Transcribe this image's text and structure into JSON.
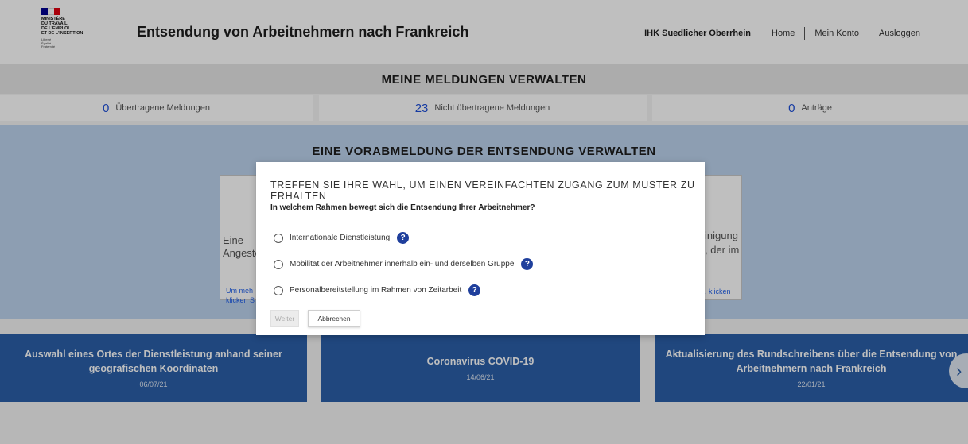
{
  "header": {
    "logo_lines": "Ministère\ndu Travail,\nde l'Emploi\net de l'Insertion",
    "logo_motto": "Liberté\nÉgalité\nFraternité",
    "site_title": "Entsendung von Arbeitnehmern nach Frankreich",
    "organization": "IHK Suedlicher Oberrhein",
    "nav": {
      "home": "Home",
      "account": "Mein Konto",
      "logout": "Ausloggen"
    }
  },
  "manage": {
    "title": "MEINE MELDUNGEN VERWALTEN",
    "counters": [
      {
        "count": "0",
        "label": "Übertragene Meldungen"
      },
      {
        "count": "23",
        "label": "Nicht übertragene Meldungen"
      },
      {
        "count": "0",
        "label": "Anträge"
      }
    ]
  },
  "preregistration": {
    "title": "EINE VORABMELDUNG DER ENTSENDUNG VERWALTEN",
    "left_card_text_1": "Eine",
    "left_card_text_2": "Angeste",
    "left_link_1": "Um meh",
    "left_link_2": "klicken S",
    "right_card_text_1": "inigung",
    "right_card_text_2": ", der im",
    "right_link": ", klicken"
  },
  "news": [
    {
      "title": "Auswahl eines Ortes der Dienstleistung anhand seiner geografischen Koordinaten",
      "date": "06/07/21"
    },
    {
      "title": "Coronavirus COVID-19",
      "date": "14/06/21"
    },
    {
      "title": "Aktualisierung des Rundschreibens über die Entsendung von Arbeitnehmern nach Frankreich",
      "date": "22/01/21"
    }
  ],
  "carousel": {
    "next_icon": "chevron-right-icon",
    "next_glyph": "›"
  },
  "modal": {
    "title": "TREFFEN SIE IHRE WAHL, UM EINEN VEREINFACHTEN ZUGANG ZUM MUSTER ZU ERHALTEN",
    "question": "In welchem Rahmen bewegt sich die Entsendung Ihrer Arbeitnehmer?",
    "options": [
      {
        "label": "Internationale Dienstleistung",
        "help": "?"
      },
      {
        "label": "Mobilität der Arbeitnehmer innerhalb ein- und derselben Gruppe",
        "help": "?"
      },
      {
        "label": "Personalbereitstellung im Rahmen von Zeitarbeit",
        "help": "?"
      }
    ],
    "next_label": "Weiter",
    "cancel_label": "Abbrechen"
  },
  "colors": {
    "accent_blue": "#2b5fa8",
    "help_icon": "#1f3f9c",
    "counter_number": "#1d4ed8",
    "flag_blue": "#000091",
    "flag_red": "#e1000f"
  }
}
